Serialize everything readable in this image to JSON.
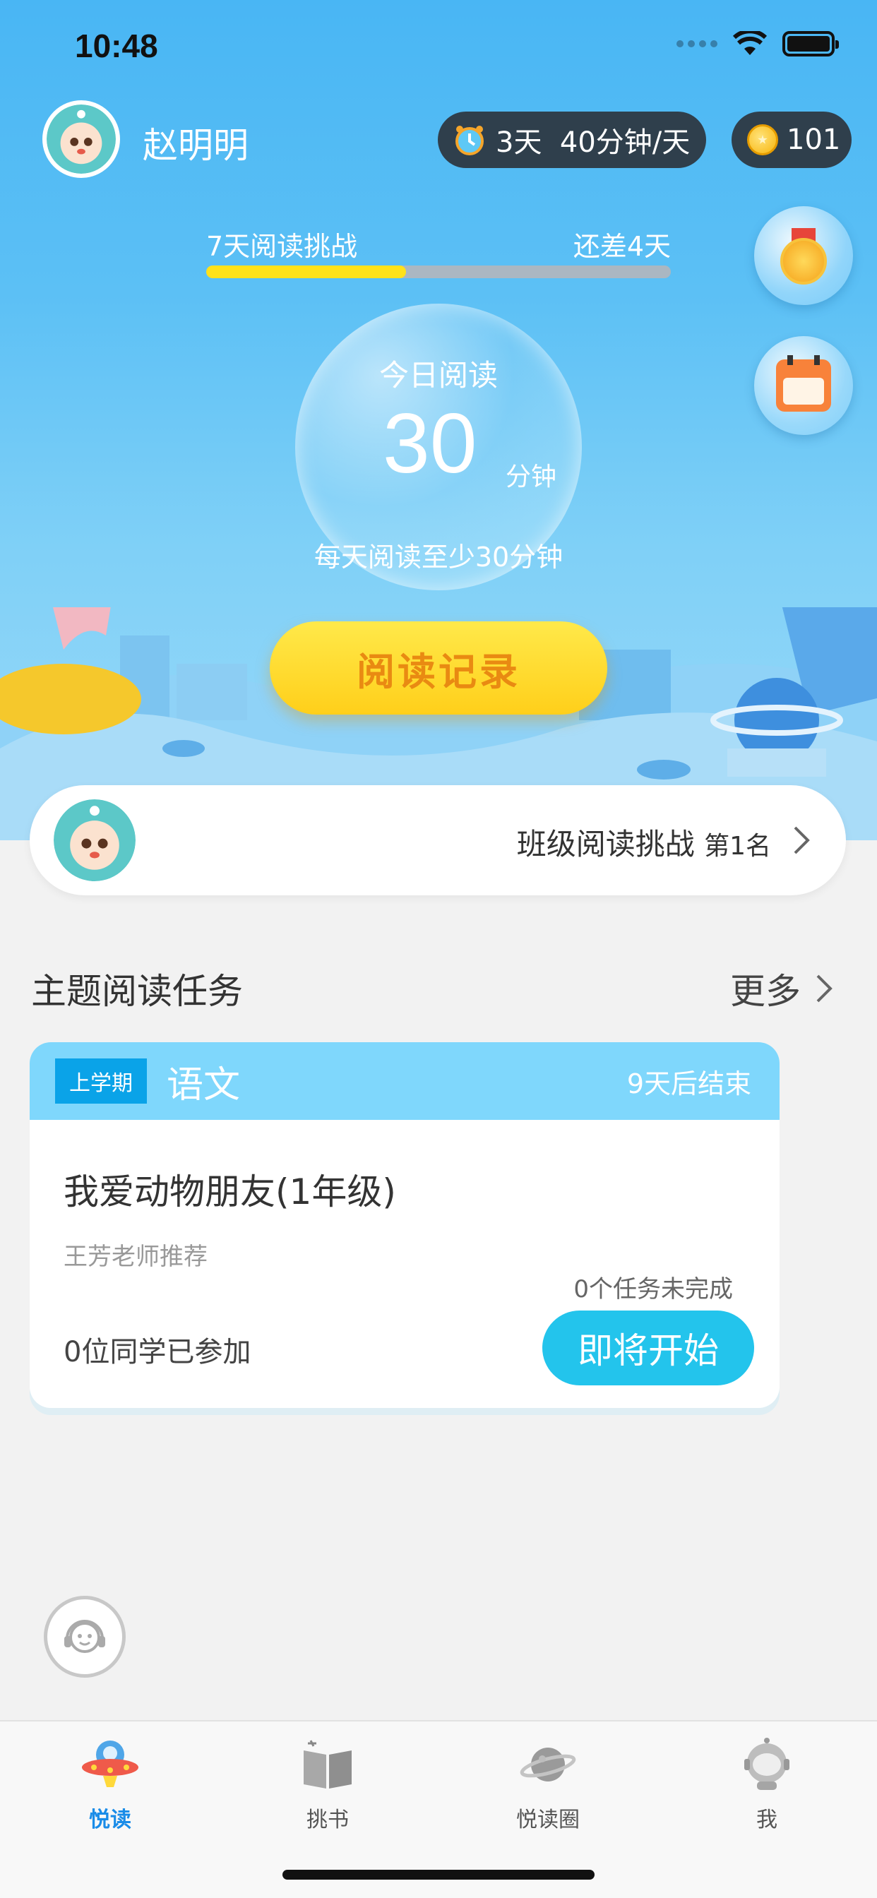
{
  "status_bar": {
    "time": "10:48"
  },
  "header": {
    "user_name": "赵明明",
    "streak": "3天  40分钟/天",
    "coins": "101"
  },
  "challenge": {
    "label": "7天阅读挑战",
    "remaining": "还差4天",
    "progress": 0.43
  },
  "today": {
    "label": "今日阅读",
    "minutes": "30",
    "unit": "分钟",
    "goal": "每天阅读至少30分钟"
  },
  "read_record_button": "阅读记录",
  "class_rank": {
    "label": "班级阅读挑战",
    "position": "第1名"
  },
  "tasks_section": {
    "title": "主题阅读任务",
    "more": "更多"
  },
  "task_card": {
    "term": "上学期",
    "subject": "语文",
    "ends": "9天后结束",
    "title": "我爱动物朋友(1年级)",
    "recommender": "王芳老师推荐",
    "tasks_left": "0个任务未完成",
    "joined": "0位同学已参加",
    "button": "即将开始"
  },
  "tabbar": {
    "items": [
      {
        "label": "悦读",
        "icon": "ufo-icon",
        "active": true
      },
      {
        "label": "挑书",
        "icon": "book-icon",
        "active": false
      },
      {
        "label": "悦读圈",
        "icon": "planet-icon",
        "active": false
      },
      {
        "label": "我",
        "icon": "astronaut-icon",
        "active": false
      }
    ]
  },
  "colors": {
    "accent": "#1a8ce8",
    "hero_top": "#49b6f4",
    "button_yellow": "#ffd21f",
    "start_button": "#23c4ec"
  }
}
